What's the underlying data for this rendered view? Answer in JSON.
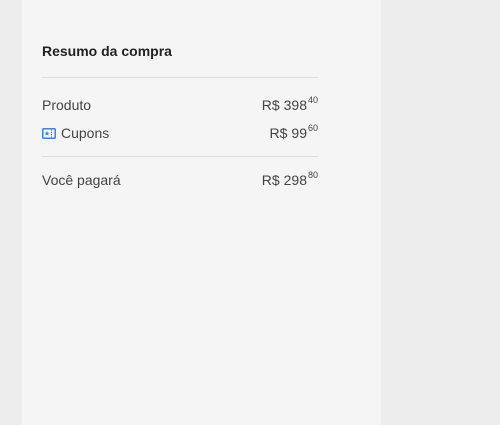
{
  "summary": {
    "title": "Resumo da compra",
    "rows": [
      {
        "label": "Produto",
        "currency": "R$",
        "integer": "398",
        "cents": "40"
      },
      {
        "label": "Cupons",
        "icon": "coupon-ticket-icon",
        "currency": "R$",
        "integer": "99",
        "cents": "60"
      },
      {
        "label": "Você pagará",
        "currency": "R$",
        "integer": "298",
        "cents": "80"
      }
    ]
  },
  "colors": {
    "page_background": "#ededed",
    "panel_background": "#f5f5f5",
    "icon_accent": "#3483fa",
    "text": "#333333"
  }
}
